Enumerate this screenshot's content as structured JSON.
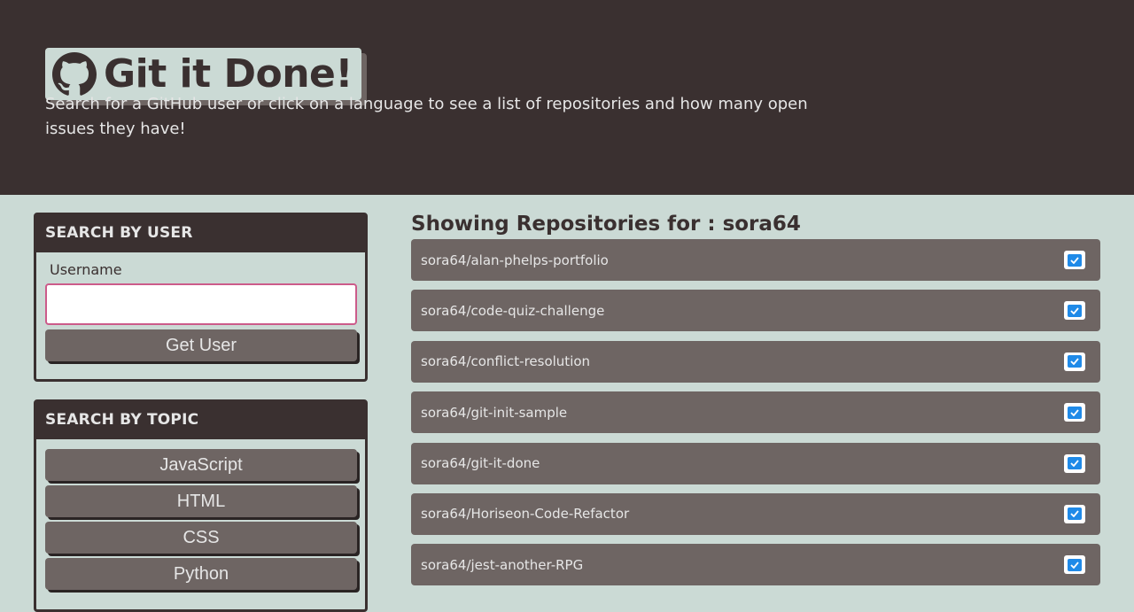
{
  "hero": {
    "title": "Git it Done!",
    "subtitle": "Search for a GitHub user or click on a language to see a list of repositories and how many open issues they have!"
  },
  "search_user": {
    "heading": "Search By User",
    "label": "Username",
    "input_value": "",
    "button_label": "Get User"
  },
  "search_topic": {
    "heading": "Search By Topic",
    "topics": [
      "JavaScript",
      "HTML",
      "CSS",
      "Python"
    ]
  },
  "repos": {
    "heading_prefix": "Showing Repositories for : ",
    "username": "sora64",
    "items": [
      {
        "name": "sora64/alan-phelps-portfolio",
        "status_icon": "check-square-icon"
      },
      {
        "name": "sora64/code-quiz-challenge",
        "status_icon": "check-square-icon"
      },
      {
        "name": "sora64/conflict-resolution",
        "status_icon": "check-square-icon"
      },
      {
        "name": "sora64/git-init-sample",
        "status_icon": "check-square-icon"
      },
      {
        "name": "sora64/git-it-done",
        "status_icon": "check-square-icon"
      },
      {
        "name": "sora64/Horiseon-Code-Refactor",
        "status_icon": "check-square-icon"
      },
      {
        "name": "sora64/jest-another-RPG",
        "status_icon": "check-square-icon"
      }
    ]
  },
  "colors": {
    "dark": "#3a3030",
    "medium": "#6e6563",
    "background": "#cbdad5",
    "input_border": "#cc5b8a",
    "checkbox_blue": "#1f8ae8"
  }
}
